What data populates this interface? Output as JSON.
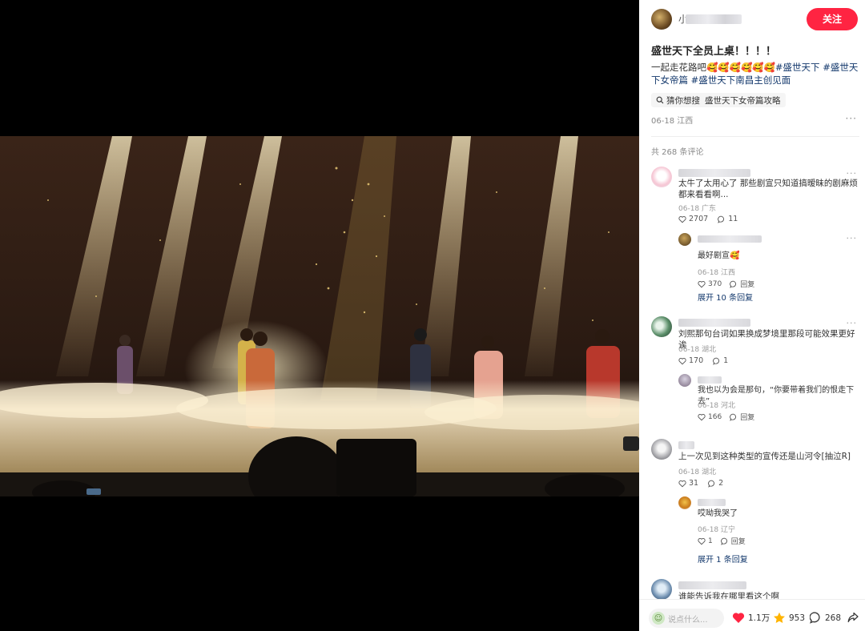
{
  "post": {
    "author_name": "小",
    "follow_label": "关注",
    "title": "盛世天下全员上桌！！！！",
    "body_prefix": "一起走花路吧🥰🥰🥰🥰🥰🥰",
    "tags": [
      "#盛世天下",
      "#盛世天下女帝篇",
      "#盛世天下南昌主创见面"
    ],
    "search_prefix": "猜你想搜",
    "search_query": "盛世天下女帝篇攻略",
    "date_location": "06-18 江西",
    "more_label": "···"
  },
  "comments_header": "共 268 条评论",
  "comments": [
    {
      "text": "太牛了太用心了 那些剧宣只知道搞暧昧的剧麻烦都来看看啊...",
      "date": "06-18 广东",
      "likes": "2707",
      "replies_count": "11",
      "replies": [
        {
          "text": "最好剧宣🥰",
          "date": "06-18 江西",
          "likes": "370",
          "reply_label": "回复"
        }
      ],
      "expand": "展开 10 条回复"
    },
    {
      "text": "刘熙那句台词如果换成梦境里那段可能效果更好诶",
      "date": "06-18 湖北",
      "likes": "170",
      "replies_count": "1",
      "replies": [
        {
          "text": "我也以为会是那句，“你要带着我们的恨走下去”",
          "date": "06-18 河北",
          "likes": "166",
          "reply_label": "回复"
        }
      ],
      "expand": ""
    },
    {
      "text": "上一次见到这种类型的宣传还是山河令[抽泣R]",
      "date": "06-18 湖北",
      "likes": "31",
      "replies_count": "2",
      "replies": [
        {
          "text": "哎呦我哭了",
          "date": "06-18 辽宁",
          "likes": "1",
          "reply_label": "回复"
        }
      ],
      "expand": "展开 1 条回复"
    },
    {
      "text": "谁能告诉我在哪里看这个啊",
      "date": "",
      "likes": "",
      "replies_count": "",
      "replies": [],
      "expand": ""
    }
  ],
  "bottom": {
    "input_placeholder": "说点什么...",
    "likes": "1.1万",
    "collects": "953",
    "comments": "268"
  },
  "colors": {
    "accent": "#ff2442",
    "tag": "#13386c",
    "star": "#ffb400"
  },
  "icons": [
    "search-icon",
    "heart-icon",
    "star-icon",
    "comment-icon",
    "share-icon",
    "more-icon",
    "reply-icon"
  ]
}
